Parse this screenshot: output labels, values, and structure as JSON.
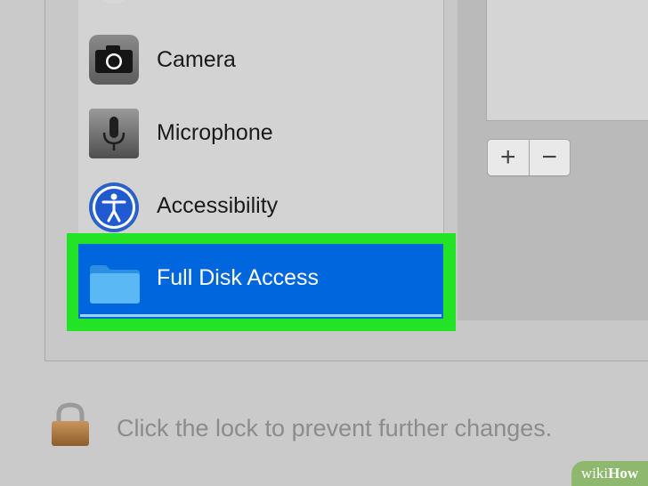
{
  "privacy_list": {
    "items": [
      {
        "label": "Camera",
        "icon": "camera-icon"
      },
      {
        "label": "Microphone",
        "icon": "microphone-icon"
      },
      {
        "label": "Accessibility",
        "icon": "accessibility-icon"
      },
      {
        "label": "Full Disk Access",
        "icon": "folder-icon",
        "selected": true
      }
    ]
  },
  "controls": {
    "add_label": "+",
    "remove_label": "−"
  },
  "footer": {
    "lock_text": "Click the lock to prevent further changes."
  },
  "watermark": {
    "prefix": "wiki",
    "suffix": "How"
  },
  "colors": {
    "selection": "#0066dd",
    "highlight_box": "#22e325"
  }
}
